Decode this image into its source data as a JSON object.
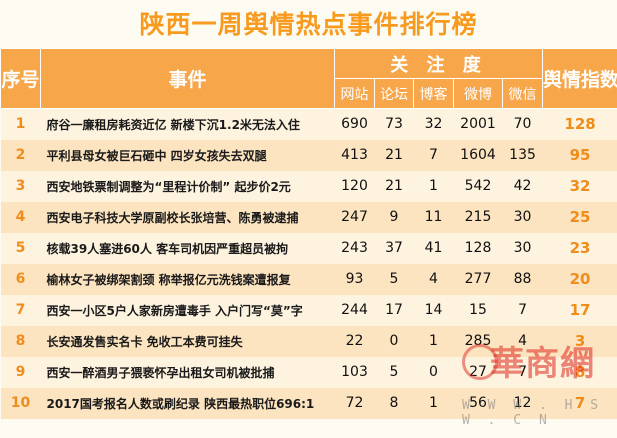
{
  "title": "陕西一周舆情热点事件排行榜",
  "headers": {
    "index": "序号",
    "event": "事件",
    "attention": "关 注 度",
    "sub": [
      "网站",
      "论坛",
      "博客",
      "微博",
      "微信"
    ],
    "score": "舆情指数"
  },
  "rows": [
    {
      "no": "1",
      "event": "府谷一廉租房耗资近亿 新楼下沉1.2米无法入住",
      "web": "690",
      "forum": "73",
      "blog": "32",
      "weibo": "2001",
      "wechat": "70",
      "index": "128"
    },
    {
      "no": "2",
      "event": "平利县母女被巨石砸中 四岁女孩失去双腿",
      "web": "413",
      "forum": "21",
      "blog": "7",
      "weibo": "1604",
      "wechat": "135",
      "index": "95"
    },
    {
      "no": "3",
      "event": "西安地铁票制调整为“里程计价制” 起步价2元",
      "web": "120",
      "forum": "21",
      "blog": "1",
      "weibo": "542",
      "wechat": "42",
      "index": "32"
    },
    {
      "no": "4",
      "event": "西安电子科技大学原副校长张培营、陈勇被逮捕",
      "web": "247",
      "forum": "9",
      "blog": "11",
      "weibo": "215",
      "wechat": "30",
      "index": "25"
    },
    {
      "no": "5",
      "event": "核载39人塞进60人 客车司机因严重超员被拘",
      "web": "243",
      "forum": "37",
      "blog": "41",
      "weibo": "128",
      "wechat": "30",
      "index": "23"
    },
    {
      "no": "6",
      "event": "榆林女子被绑架割颈 称举报亿元洗钱案遭报复",
      "web": "93",
      "forum": "5",
      "blog": "4",
      "weibo": "277",
      "wechat": "88",
      "index": "20"
    },
    {
      "no": "7",
      "event": "西安一小区5户人家新房遭毒手 入户门写“莫”字",
      "web": "244",
      "forum": "17",
      "blog": "14",
      "weibo": "15",
      "wechat": "7",
      "index": "17"
    },
    {
      "no": "8",
      "event": "长安通发售实名卡 免收工本费可挂失",
      "web": "22",
      "forum": "0",
      "blog": "1",
      "weibo": "285",
      "wechat": "4",
      "index": "3"
    },
    {
      "no": "9",
      "event": "西安一醉酒男子猥亵怀孕出租女司机被批捕",
      "web": "103",
      "forum": "5",
      "blog": "0",
      "weibo": "27",
      "wechat": "7",
      "index": "8"
    },
    {
      "no": "10",
      "event": "2017国考报名人数或刷纪录 陕西最热职位696:1",
      "web": "72",
      "forum": "8",
      "blog": "1",
      "weibo": "56",
      "wechat": "12",
      "index": "7"
    }
  ],
  "watermark": {
    "text": "華商網",
    "url": "W W W . H S W . C N"
  }
}
